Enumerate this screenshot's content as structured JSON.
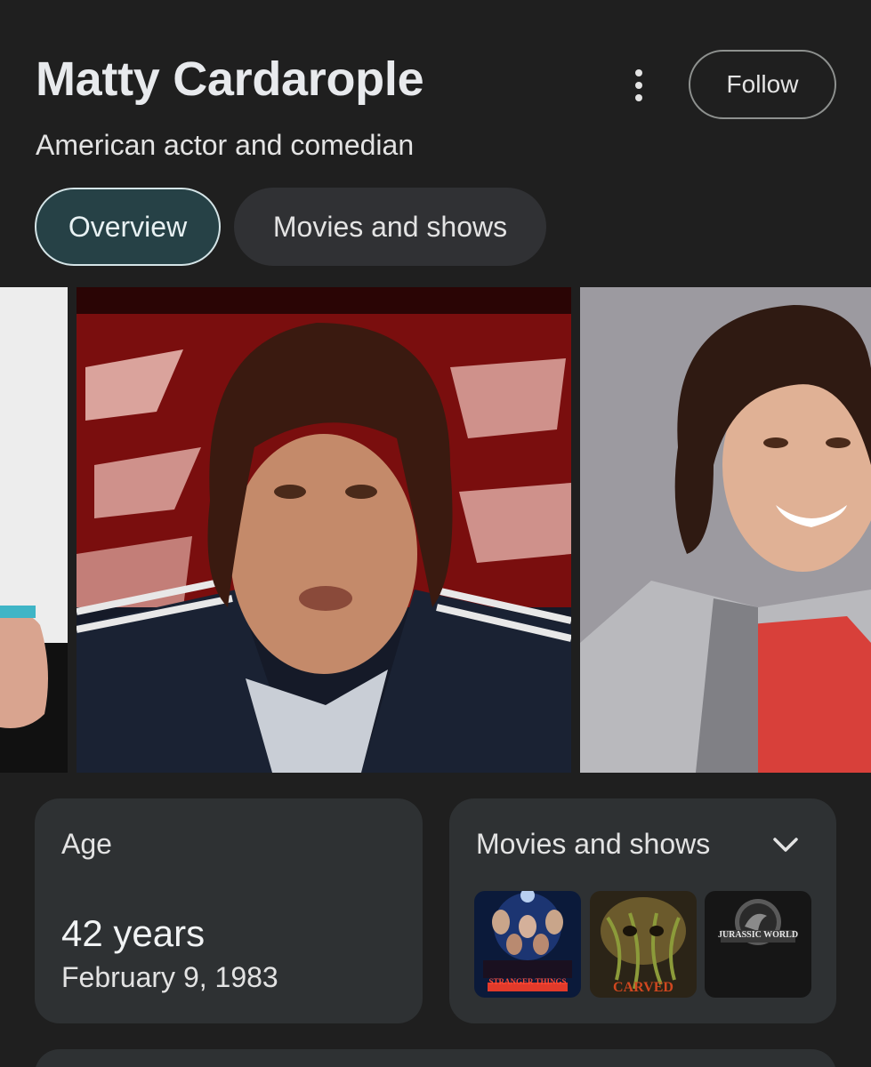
{
  "header": {
    "name": "Matty Cardarople",
    "description": "American actor and comedian",
    "follow_label": "Follow",
    "more_icon": "more-vert-icon"
  },
  "tabs": [
    {
      "label": "Overview",
      "selected": true
    },
    {
      "label": "Movies and shows",
      "selected": false
    }
  ],
  "age_card": {
    "label": "Age",
    "value": "42 years",
    "birth_date": "February 9, 1983"
  },
  "movies_card": {
    "label": "Movies and shows",
    "expand_icon": "chevron-down-icon",
    "posters": [
      {
        "title": "STRANGER THINGS"
      },
      {
        "title": "CARVED"
      },
      {
        "title": "JURASSIC WORLD"
      }
    ]
  },
  "colors": {
    "background": "#1f1f1f",
    "card": "#2e3133",
    "selected_tab_bg": "#264146",
    "selected_tab_border": "#d4e4e7"
  }
}
